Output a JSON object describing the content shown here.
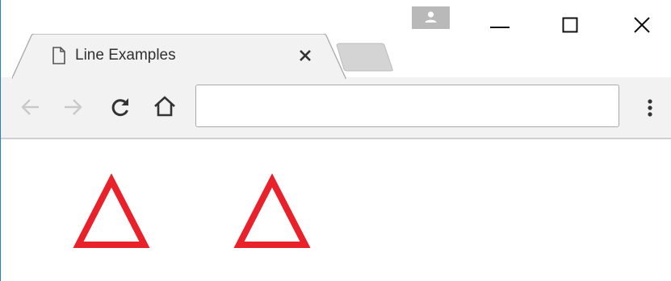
{
  "browser": {
    "tab": {
      "title": "Line Examples",
      "icon": "page-icon",
      "close_icon": "close-icon"
    },
    "new_tab_icon": "new-tab-icon",
    "window_controls": {
      "profile_icon": "profile-icon",
      "minimize_icon": "minimize-icon",
      "maximize_icon": "maximize-icon",
      "close_icon": "close-icon"
    },
    "toolbar": {
      "back_icon": "back-arrow-icon",
      "forward_icon": "forward-arrow-icon",
      "reload_icon": "reload-icon",
      "home_icon": "home-icon",
      "address_value": "",
      "menu_icon": "more-vertical-icon"
    }
  },
  "page": {
    "shapes": [
      {
        "type": "triangle",
        "stroke": "#e8212a",
        "fill": "none"
      },
      {
        "type": "triangle",
        "stroke": "#e8212a",
        "fill": "none"
      }
    ]
  },
  "colors": {
    "accent_window_border": "#2b79d7",
    "toolbar_bg": "#f2f2f2",
    "shape_stroke": "#e8212a"
  }
}
